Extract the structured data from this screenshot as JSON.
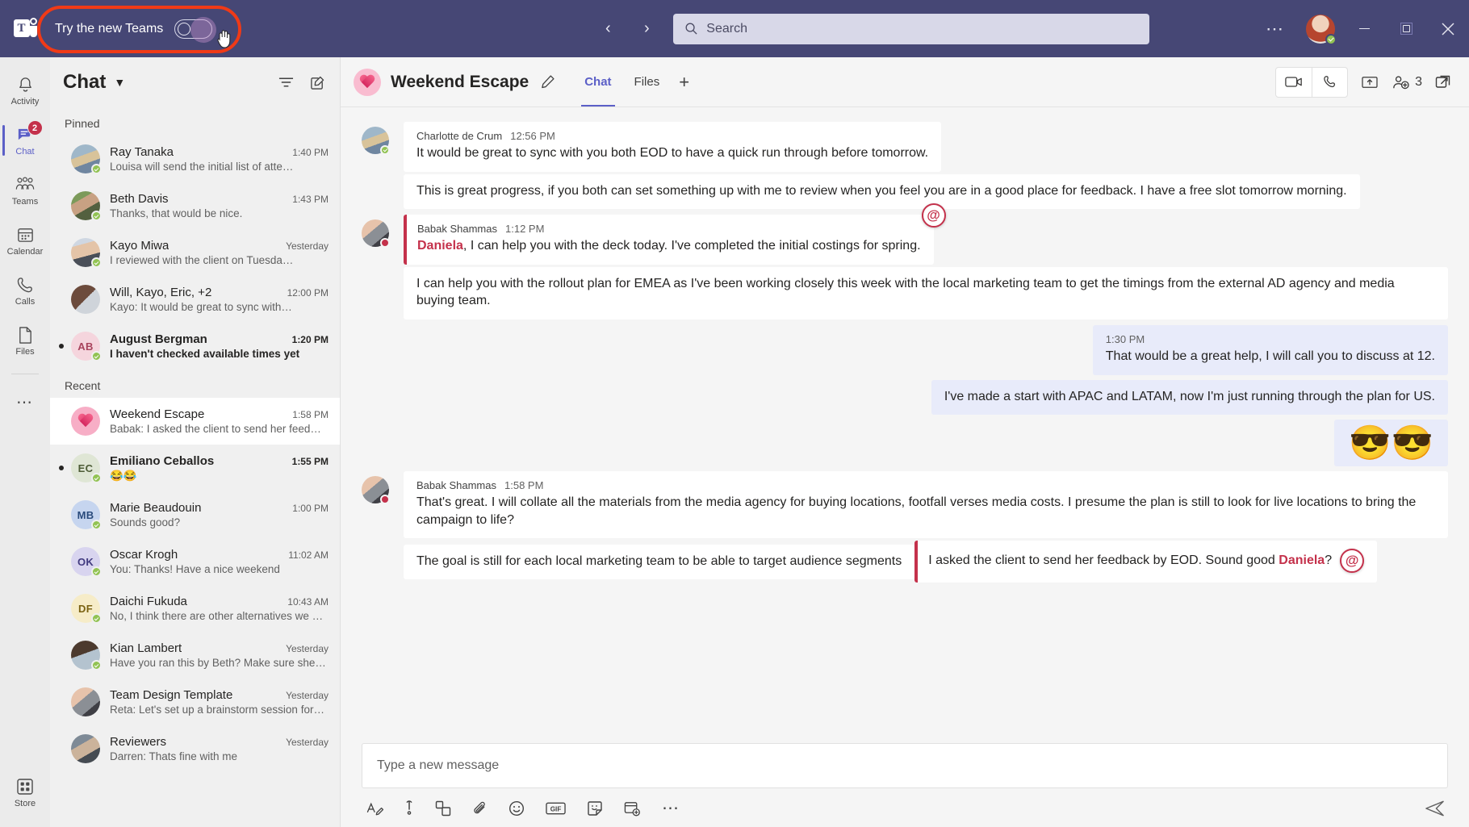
{
  "titlebar": {
    "try_new_label": "Try the new Teams",
    "toggle_state": "off",
    "search_placeholder": "Search",
    "search_value": "",
    "back_icon": "chevron-left-icon",
    "forward_icon": "chevron-right-icon",
    "more_icon": "more-options-icon",
    "minimize_icon": "minimize-icon",
    "maximize_icon": "maximize-icon",
    "close_icon": "close-icon"
  },
  "rail": {
    "items": [
      {
        "label": "Activity",
        "icon": "bell-icon",
        "badge": "",
        "active": false
      },
      {
        "label": "Chat",
        "icon": "chat-icon",
        "badge": "2",
        "active": true
      },
      {
        "label": "Teams",
        "icon": "teams-people-icon",
        "badge": "",
        "active": false
      },
      {
        "label": "Calendar",
        "icon": "calendar-icon",
        "badge": "",
        "active": false
      },
      {
        "label": "Calls",
        "icon": "phone-icon",
        "badge": "",
        "active": false
      },
      {
        "label": "Files",
        "icon": "file-icon",
        "badge": "",
        "active": false
      }
    ],
    "more_label": "...",
    "store": {
      "label": "Store",
      "icon": "store-grid-icon"
    }
  },
  "chatlist": {
    "title": "Chat",
    "caret_icon": "chevron-down-icon",
    "filter_icon": "filter-icon",
    "compose_icon": "new-chat-icon",
    "sections": [
      {
        "label": "Pinned",
        "rows": [
          {
            "name": "Ray Tanaka",
            "time": "1:40 PM",
            "preview": "Louisa will send the initial list of atte…",
            "avatar_kind": "photo",
            "avatar_class": "ph1",
            "initials": "",
            "unread": false,
            "selected": false
          },
          {
            "name": "Beth Davis",
            "time": "1:43 PM",
            "preview": "Thanks, that would be nice.",
            "avatar_kind": "photo",
            "avatar_class": "ph2",
            "initials": "",
            "unread": false,
            "selected": false
          },
          {
            "name": "Kayo Miwa",
            "time": "Yesterday",
            "preview": "I reviewed with the client on Tuesda…",
            "avatar_kind": "photo",
            "avatar_class": "ph3",
            "initials": "",
            "unread": false,
            "selected": false
          },
          {
            "name": "Will, Kayo, Eric, +2",
            "time": "12:00 PM",
            "preview": "Kayo: It would be great to sync with…",
            "avatar_kind": "group",
            "avatar_class": "ph4",
            "initials": "",
            "unread": false,
            "selected": false
          },
          {
            "name": "August Bergman",
            "time": "1:20 PM",
            "preview": "I haven't checked available times yet",
            "avatar_kind": "initials",
            "avatar_class": "",
            "initials": "AB",
            "avatar_bg": "#f5d5dd",
            "avatar_fg": "#a8435c",
            "unread": true,
            "selected": false
          }
        ]
      },
      {
        "label": "Recent",
        "rows": [
          {
            "name": "Weekend Escape",
            "time": "1:58 PM",
            "preview": "Babak: I asked the client to send her feed…",
            "avatar_kind": "heart",
            "avatar_class": "ph-heart",
            "initials": "",
            "unread": false,
            "selected": true
          },
          {
            "name": "Emiliano Ceballos",
            "time": "1:55 PM",
            "preview": "😂😂",
            "avatar_kind": "initials",
            "avatar_class": "",
            "initials": "EC",
            "avatar_bg": "#dfe6d5",
            "avatar_fg": "#4d5c36",
            "unread": true,
            "selected": false
          },
          {
            "name": "Marie Beaudouin",
            "time": "1:00 PM",
            "preview": "Sounds good?",
            "avatar_kind": "initials",
            "avatar_class": "",
            "initials": "MB",
            "avatar_bg": "#c6d5ef",
            "avatar_fg": "#2a4b7c",
            "unread": false,
            "selected": false
          },
          {
            "name": "Oscar Krogh",
            "time": "11:02 AM",
            "preview": "You: Thanks! Have a nice weekend",
            "avatar_kind": "initials",
            "avatar_class": "",
            "initials": "OK",
            "avatar_bg": "#d8d4ef",
            "avatar_fg": "#413a80",
            "unread": false,
            "selected": false
          },
          {
            "name": "Daichi Fukuda",
            "time": "10:43 AM",
            "preview": "No, I think there are other alternatives we c…",
            "avatar_kind": "initials",
            "avatar_class": "",
            "initials": "DF",
            "avatar_bg": "#f6ecc8",
            "avatar_fg": "#7a6212",
            "unread": false,
            "selected": false
          },
          {
            "name": "Kian Lambert",
            "time": "Yesterday",
            "preview": "Have you ran this by Beth? Make sure she is…",
            "avatar_kind": "photo",
            "avatar_class": "ph5",
            "initials": "",
            "unread": false,
            "selected": false
          },
          {
            "name": "Team Design Template",
            "time": "Yesterday",
            "preview": "Reta: Let's set up a brainstorm session for…",
            "avatar_kind": "group",
            "avatar_class": "ph6",
            "initials": "",
            "unread": false,
            "selected": false
          },
          {
            "name": "Reviewers",
            "time": "Yesterday",
            "preview": "Darren: Thats fine with me",
            "avatar_kind": "group",
            "avatar_class": "ph7",
            "initials": "",
            "unread": false,
            "selected": false
          }
        ]
      }
    ]
  },
  "chat_header": {
    "title": "Weekend Escape",
    "avatar_icon": "heart-icon",
    "edit_icon": "pencil-icon",
    "tabs": [
      {
        "label": "Chat",
        "active": true
      },
      {
        "label": "Files",
        "active": false
      }
    ],
    "add_tab_label": "+",
    "video_icon": "video-call-icon",
    "audio_icon": "audio-call-icon",
    "share_icon": "share-screen-icon",
    "people_icon": "add-people-icon",
    "people_count": "3",
    "popout_icon": "pop-out-icon"
  },
  "messages": [
    {
      "type": "group",
      "side": "left",
      "author": "Charlotte de Crum",
      "time": "12:56 PM",
      "avatar_class": "ph1",
      "presence": "avail",
      "bubbles": [
        {
          "text": "It would be great to sync with you both EOD to have a quick run through before tomorrow.",
          "mention": false,
          "meta": true
        },
        {
          "text": "This is great progress, if you both can set something up with me to review when you feel you are in a good place for feedback. I have a free slot tomorrow morning.",
          "mention": false,
          "meta": false
        }
      ]
    },
    {
      "type": "group",
      "side": "left",
      "author": "Babak Shammas",
      "time": "1:12 PM",
      "avatar_class": "ph6",
      "presence": "busy",
      "bubbles": [
        {
          "text": ", I can help you with the deck today. I've completed the initial costings for spring.",
          "mention_name": "Daniela",
          "mention": true,
          "meta": true,
          "at_badge": "@"
        },
        {
          "text": "I can help you with the rollout plan for EMEA as I've been working closely this week with the local marketing team to get the timings from the external AD agency and media buying team.",
          "mention": false,
          "meta": false
        }
      ]
    },
    {
      "type": "own",
      "side": "right",
      "time": "1:30 PM",
      "text": "That would be a great help, I will call you to discuss at 12."
    },
    {
      "type": "own",
      "side": "right",
      "time": "",
      "text": "I've made a start with APAC and LATAM, now I'm just running through the plan for US."
    },
    {
      "type": "own-emoji",
      "side": "right",
      "text": "😎😎"
    },
    {
      "type": "group",
      "side": "left",
      "author": "Babak Shammas",
      "time": "1:58 PM",
      "avatar_class": "ph6",
      "presence": "busy",
      "bubbles": [
        {
          "text": "That's great. I will collate all the materials from the media agency for buying locations, footfall verses media costs. I presume the plan is still to look for live locations to bring the campaign to life?",
          "mention": false,
          "meta": true
        },
        {
          "text": "The goal is still for each local marketing team to be able to target audience segments",
          "mention": false,
          "meta": false
        },
        {
          "text_pre": "I asked the client to send her feedback by EOD. Sound good ",
          "mention_name": "Daniela",
          "text_post": "?",
          "mention": true,
          "meta": false,
          "at_badge": "@"
        }
      ]
    }
  ],
  "composer": {
    "placeholder": "Type a new message",
    "value": "",
    "tools": [
      {
        "icon": "format-text-icon",
        "label": "Format"
      },
      {
        "icon": "important-icon",
        "label": "Set delivery options"
      },
      {
        "icon": "attach-loop-icon",
        "label": "Loop component"
      },
      {
        "icon": "attach-file-icon",
        "label": "Attach"
      },
      {
        "icon": "emoji-icon",
        "label": "Emoji"
      },
      {
        "icon": "gif-icon",
        "label": "GIF"
      },
      {
        "icon": "sticker-icon",
        "label": "Sticker"
      },
      {
        "icon": "apps-icon",
        "label": "Apps"
      },
      {
        "icon": "more-options-icon",
        "label": "More options"
      }
    ],
    "send_icon": "send-icon"
  },
  "colors": {
    "brand_purple": "#464775",
    "accent": "#5b5fc7",
    "mention_red": "#c4314b",
    "highlight_ring": "#f03a17",
    "presence_available": "#92c353",
    "own_bubble": "#e8ebfa"
  }
}
